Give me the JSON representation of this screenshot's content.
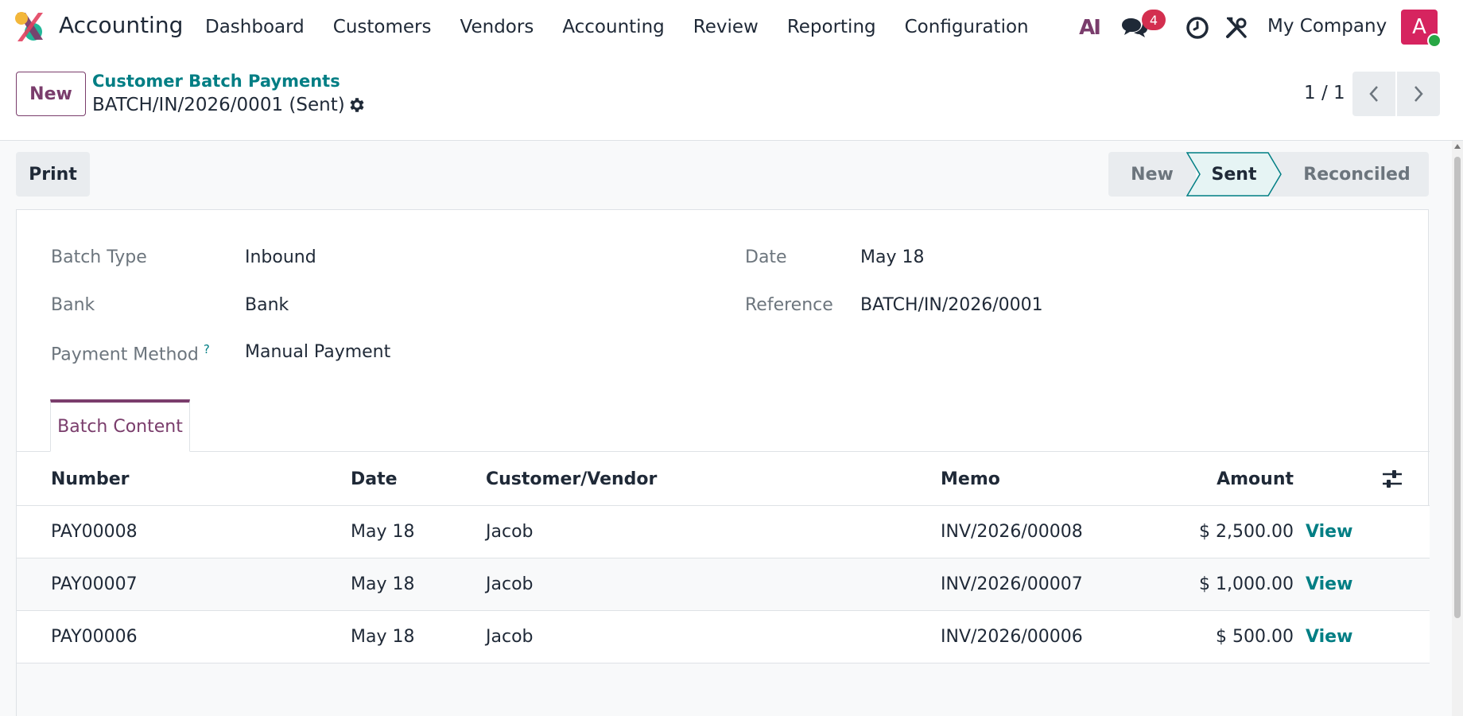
{
  "app": {
    "name": "Accounting"
  },
  "menu": [
    {
      "label": "Dashboard"
    },
    {
      "label": "Customers"
    },
    {
      "label": "Vendors"
    },
    {
      "label": "Accounting"
    },
    {
      "label": "Review"
    },
    {
      "label": "Reporting"
    },
    {
      "label": "Configuration"
    }
  ],
  "systray": {
    "ai_label": "AI",
    "chat_count": "4",
    "company": "My Company",
    "avatar_letter": "A"
  },
  "control": {
    "new_label": "New",
    "breadcrumb_parent": "Customer Batch Payments",
    "breadcrumb_current": "BATCH/IN/2026/0001 (Sent)",
    "pager": "1 / 1"
  },
  "statusbar": {
    "print_label": "Print",
    "stages": [
      "New",
      "Sent",
      "Reconciled"
    ],
    "active_stage": "Sent"
  },
  "form": {
    "batch_type_label": "Batch Type",
    "batch_type_value": "Inbound",
    "bank_label": "Bank",
    "bank_value": "Bank",
    "payment_method_label": "Payment Method",
    "payment_method_help": "?",
    "payment_method_value": "Manual Payment",
    "date_label": "Date",
    "date_value": "May 18",
    "reference_label": "Reference",
    "reference_value": "BATCH/IN/2026/0001"
  },
  "tabs": [
    {
      "label": "Batch Content"
    }
  ],
  "table": {
    "columns": [
      "Number",
      "Date",
      "Customer/Vendor",
      "Memo",
      "Amount"
    ],
    "rows": [
      {
        "number": "PAY00008",
        "date": "May 18",
        "partner": "Jacob",
        "memo": "INV/2026/00008",
        "amount": "$ 2,500.00",
        "action": "View"
      },
      {
        "number": "PAY00007",
        "date": "May 18",
        "partner": "Jacob",
        "memo": "INV/2026/00007",
        "amount": "$ 1,000.00",
        "action": "View"
      },
      {
        "number": "PAY00006",
        "date": "May 18",
        "partner": "Jacob",
        "memo": "INV/2026/00006",
        "amount": "$ 500.00",
        "action": "View"
      }
    ]
  },
  "colors": {
    "brand": "#7a3d6c",
    "link": "#017e84",
    "badge": "#d32f4f",
    "avatar": "#d6245f"
  },
  "icons": [
    "app-logo",
    "chat-icon",
    "clock-icon",
    "tools-icon",
    "gear-icon",
    "chevron-left-icon",
    "chevron-right-icon",
    "column-settings-icon"
  ]
}
